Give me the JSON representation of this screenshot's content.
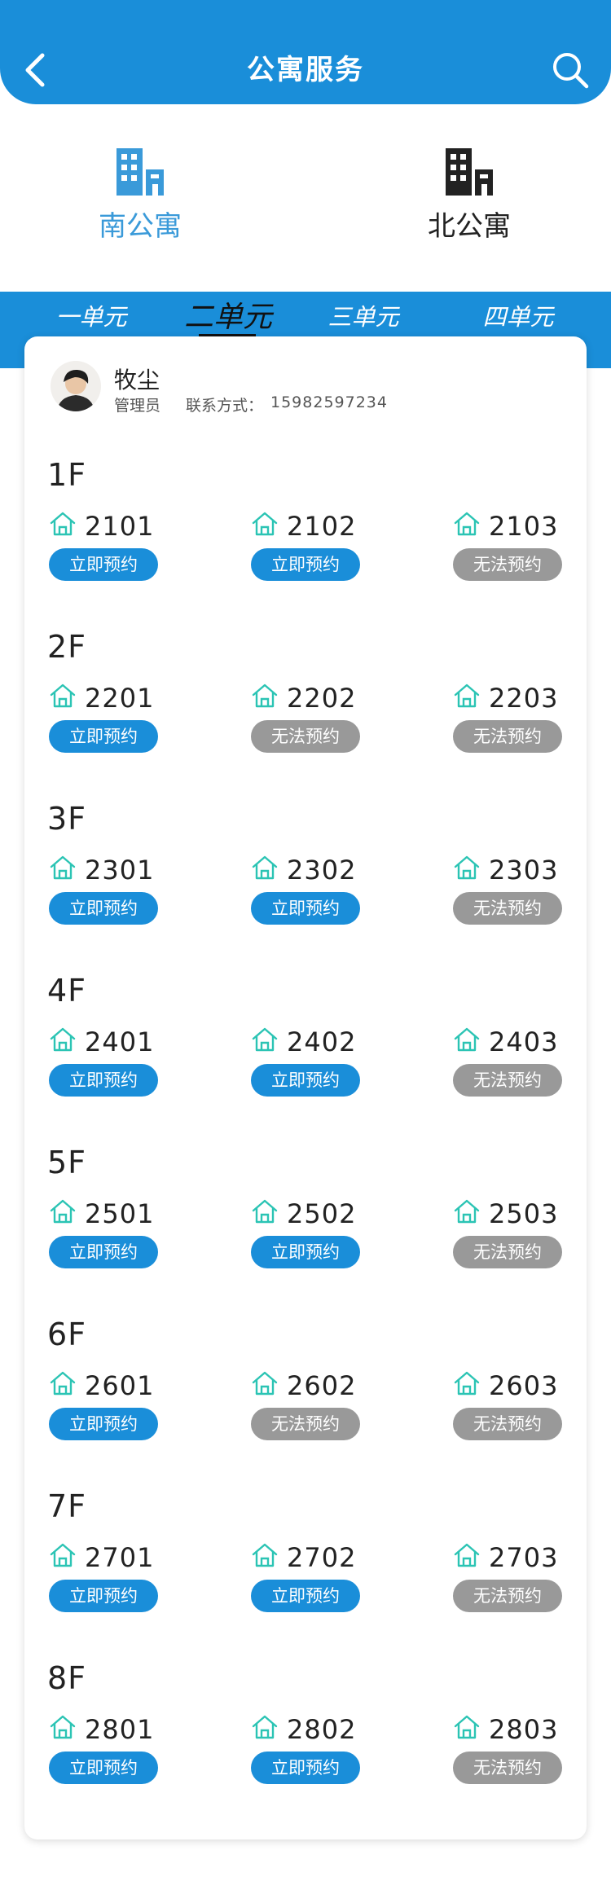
{
  "header": {
    "title": "公寓服务"
  },
  "buildings": [
    {
      "label": "南公寓",
      "color": "#3a9ad9"
    },
    {
      "label": "北公寓",
      "color": "#222222"
    }
  ],
  "units": [
    "一单元",
    "二单元",
    "三单元",
    "四单元"
  ],
  "admin": {
    "name": "牧尘",
    "role": "管理员",
    "contact_label": "联系方式：",
    "phone": "15982597234"
  },
  "labels": {
    "available": "立即预约",
    "unavailable": "无法预约"
  },
  "floors": [
    {
      "label": "1F",
      "rooms": [
        {
          "num": "2101",
          "available": true
        },
        {
          "num": "2102",
          "available": true
        },
        {
          "num": "2103",
          "available": false
        }
      ]
    },
    {
      "label": "2F",
      "rooms": [
        {
          "num": "2201",
          "available": true
        },
        {
          "num": "2202",
          "available": false
        },
        {
          "num": "2203",
          "available": false
        }
      ]
    },
    {
      "label": "3F",
      "rooms": [
        {
          "num": "2301",
          "available": true
        },
        {
          "num": "2302",
          "available": true
        },
        {
          "num": "2303",
          "available": false
        }
      ]
    },
    {
      "label": "4F",
      "rooms": [
        {
          "num": "2401",
          "available": true
        },
        {
          "num": "2402",
          "available": true
        },
        {
          "num": "2403",
          "available": false
        }
      ]
    },
    {
      "label": "5F",
      "rooms": [
        {
          "num": "2501",
          "available": true
        },
        {
          "num": "2502",
          "available": true
        },
        {
          "num": "2503",
          "available": false
        }
      ]
    },
    {
      "label": "6F",
      "rooms": [
        {
          "num": "2601",
          "available": true
        },
        {
          "num": "2602",
          "available": false
        },
        {
          "num": "2603",
          "available": false
        }
      ]
    },
    {
      "label": "7F",
      "rooms": [
        {
          "num": "2701",
          "available": true
        },
        {
          "num": "2702",
          "available": true
        },
        {
          "num": "2703",
          "available": false
        }
      ]
    },
    {
      "label": "8F",
      "rooms": [
        {
          "num": "2801",
          "available": true
        },
        {
          "num": "2802",
          "available": true
        },
        {
          "num": "2803",
          "available": false
        }
      ]
    }
  ]
}
